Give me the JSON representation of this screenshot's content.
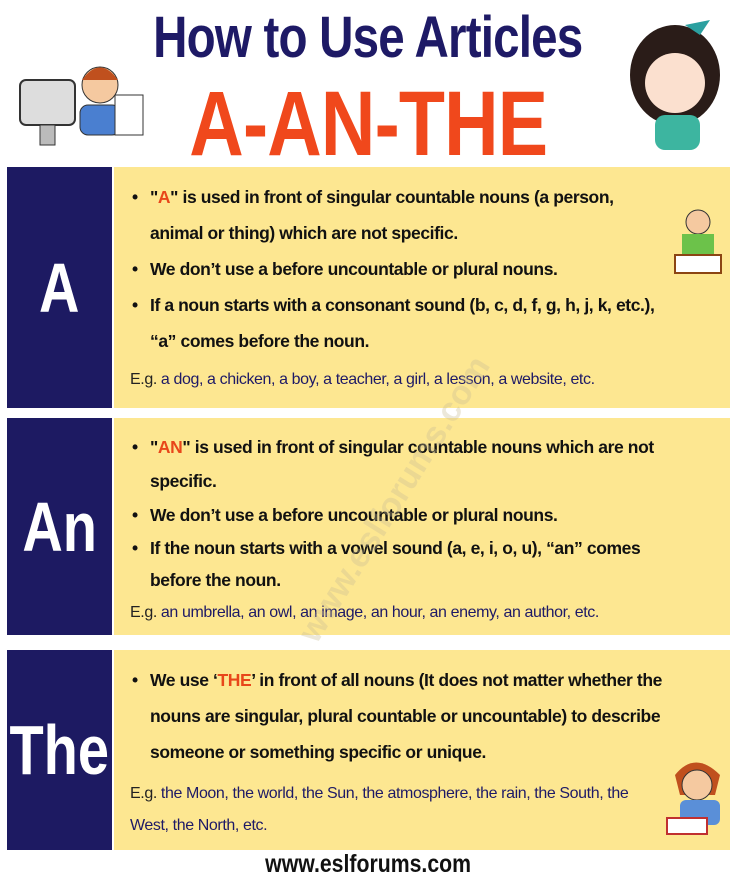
{
  "header": {
    "title": "How to Use Articles",
    "subtitle": "A-AN-THE"
  },
  "sections": [
    {
      "label": "A",
      "bullets": [
        {
          "pre": "\"",
          "hl": "A",
          "post": "\" is used in front of singular countable nouns (a person, animal or thing) which are not specific."
        },
        {
          "pre": "We don’t use a before uncountable or plural nouns.",
          "hl": "",
          "post": ""
        },
        {
          "pre": "If a noun starts with a consonant sound (b, c, d, f, g, h, j, k, etc.), “a” comes before the noun.",
          "hl": "",
          "post": ""
        }
      ],
      "eg_prefix": "E.g.",
      "eg": "a dog, a chicken, a boy, a teacher, a girl, a lesson, a website, etc."
    },
    {
      "label": "An",
      "bullets": [
        {
          "pre": "\"",
          "hl": "AN",
          "post": "\" is used in front of singular countable nouns which are not specific."
        },
        {
          "pre": "We don’t use a before uncountable or plural nouns.",
          "hl": "",
          "post": ""
        },
        {
          "pre": "If the noun starts with a vowel sound (a, e, i, o, u), “an” comes before the noun.",
          "hl": "",
          "post": ""
        }
      ],
      "eg_prefix": "E.g.",
      "eg": "an umbrella, an owl, an image, an hour, an enemy, an author, etc."
    },
    {
      "label": "The",
      "bullets": [
        {
          "pre": "We use ‘",
          "hl": "THE",
          "post": "’ in front of all nouns (It does not matter whether the nouns are singular, plural countable or uncountable) to describe someone or something specific or unique."
        }
      ],
      "eg_prefix": "E.g.",
      "eg": "the Moon, the world, the Sun, the atmosphere, the rain, the South, the West, the North, etc."
    }
  ],
  "watermark": "www.eslforums.com",
  "footer": "www.eslforums.com",
  "colors": {
    "navy": "#1d1a62",
    "accent": "#f0481c",
    "panel": "#fde791"
  }
}
